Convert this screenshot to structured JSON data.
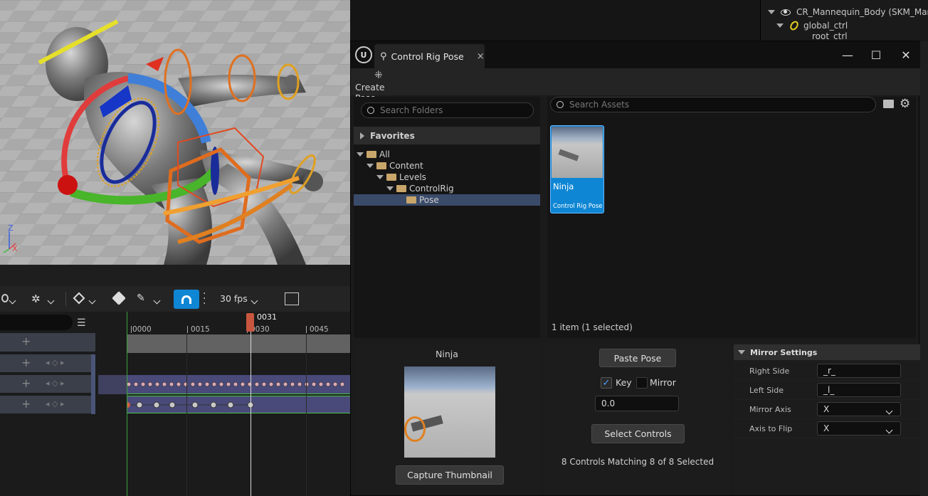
{
  "outliner": {
    "root_label": "CR_Mannequin_Body",
    "root_type": "(SKM_Man",
    "child1": "global_ctrl",
    "child2": "root_ctrl"
  },
  "viewport": {
    "axis_z": "Z",
    "axis_x": "X"
  },
  "sequencer": {
    "fps_label": "30 fps",
    "current_frame": "0031",
    "ticks": [
      "0000",
      "0015",
      "0030",
      "0045"
    ]
  },
  "window": {
    "tab_title": "Control Rig Pose",
    "close_glyph": "×",
    "minimize_glyph": "—",
    "maximize_glyph": "☐",
    "window_close_glyph": "✕",
    "create_pose_label": "Create Pose"
  },
  "folders": {
    "search_placeholder": "Search Folders",
    "favorites_label": "Favorites",
    "tree": [
      {
        "label": "All",
        "depth": 0,
        "selected": false
      },
      {
        "label": "Content",
        "depth": 1,
        "selected": false
      },
      {
        "label": "Levels",
        "depth": 2,
        "selected": false
      },
      {
        "label": "ControlRig",
        "depth": 3,
        "selected": false
      },
      {
        "label": "Pose",
        "depth": 4,
        "selected": true
      }
    ]
  },
  "assets": {
    "search_placeholder": "Search Assets",
    "item_name": "Ninja",
    "item_type": "Control Rig Pose",
    "status": "1 item (1 selected)"
  },
  "preview": {
    "name": "Ninja",
    "capture_label": "Capture Thumbnail"
  },
  "pose": {
    "paste_label": "Paste Pose",
    "key_label": "Key",
    "key_checked": true,
    "mirror_label": "Mirror",
    "mirror_checked": false,
    "blend_value": "0.0",
    "select_controls_label": "Select Controls",
    "match_status": "8 Controls Matching 8 of 8 Selected"
  },
  "mirror_settings": {
    "header": "Mirror Settings",
    "right_side_label": "Right Side",
    "right_side_value": "_r_",
    "left_side_label": "Left Side",
    "left_side_value": "_l_",
    "mirror_axis_label": "Mirror Axis",
    "mirror_axis_value": "X",
    "axis_to_flip_label": "Axis to Flip",
    "axis_to_flip_value": "X"
  },
  "colors": {
    "accent_blue": "#0e86d4",
    "selection_bg": "#3a4b6a",
    "playhead": "#c8563e"
  }
}
